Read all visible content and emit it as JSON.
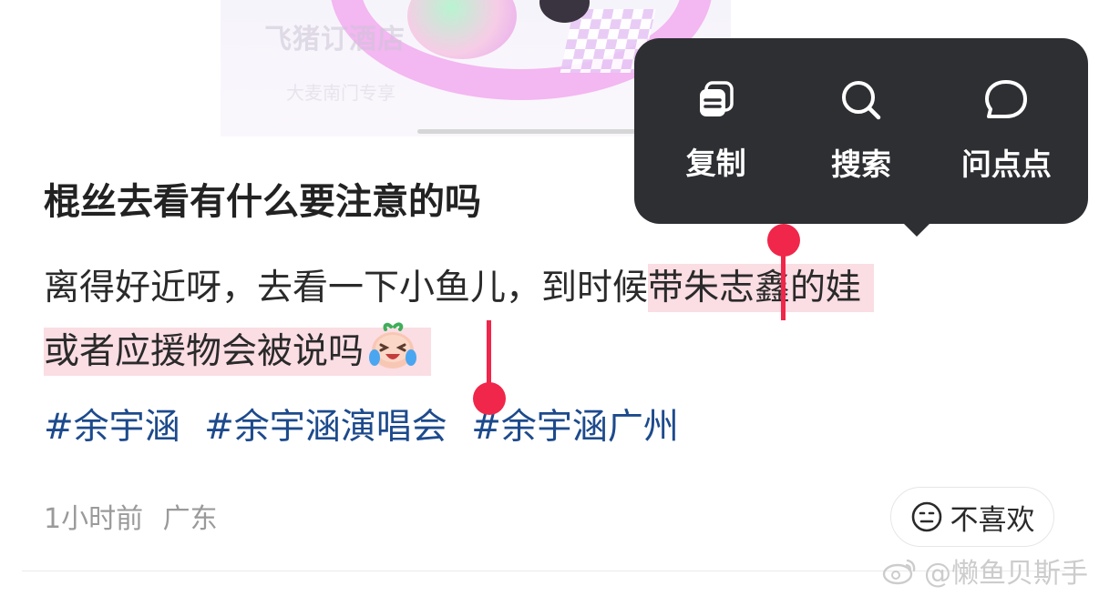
{
  "banner": {
    "title": "飞猪订酒店",
    "subtitle": "大麦南门专享"
  },
  "popup_menu": {
    "items": [
      {
        "label": "复制",
        "icon": "copy-icon"
      },
      {
        "label": "搜索",
        "icon": "search-icon"
      },
      {
        "label": "问点点",
        "icon": "chat-bubble-icon"
      }
    ]
  },
  "post": {
    "title": "棍丝去看有什么要注意的吗",
    "body_line1_plain": "离得好近呀，去看一下小鱼儿，到时候",
    "body_line1_selected": "带朱志鑫的娃",
    "body_line2_selected": "或者应援物会被说吗",
    "emoji": "crying-laughing-emoji",
    "hashtags": [
      "#余宇涵",
      "#余宇涵演唱会",
      "#余宇涵广州"
    ],
    "time": "1小时前",
    "location": "广东",
    "dislike_label": "不喜欢"
  },
  "watermark": {
    "text": "@懒鱼贝斯手",
    "icon": "weibo-icon"
  },
  "colors": {
    "selection_handle": "#f0264a",
    "selection_bg": "#fbdde4",
    "hashtag": "#1d4a8c",
    "popup_bg": "#2e2f33"
  }
}
